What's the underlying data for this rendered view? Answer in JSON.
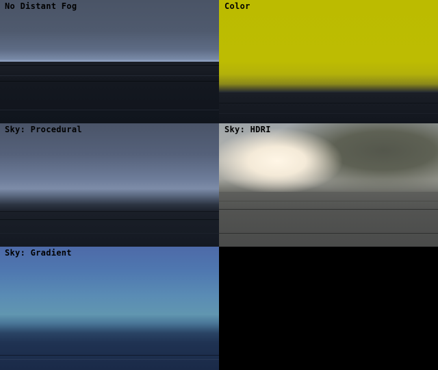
{
  "panels": [
    {
      "label": "No Distant Fog"
    },
    {
      "label": "Color"
    },
    {
      "label": "Sky: Procedural"
    },
    {
      "label": "Sky: HDRI"
    },
    {
      "label": "Sky: Gradient"
    }
  ],
  "colors": {
    "fog_color_yellow": "#bcbb00",
    "empty_panel": "#000000"
  }
}
